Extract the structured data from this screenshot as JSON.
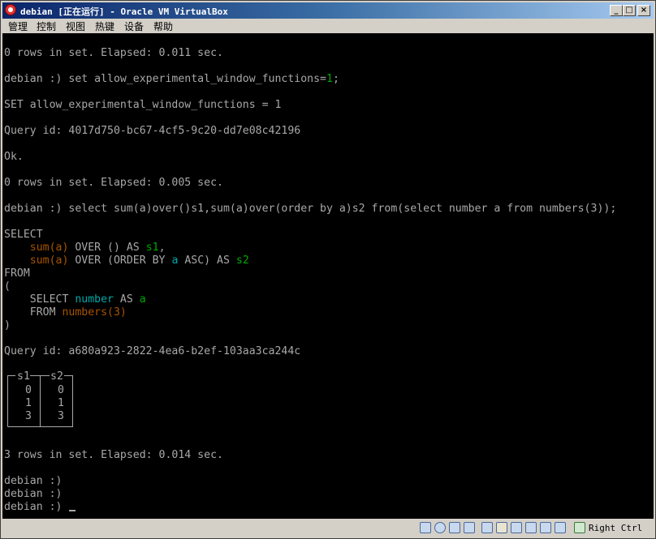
{
  "window": {
    "title": "debian [正在运行] - Oracle VM VirtualBox"
  },
  "menu": [
    "管理",
    "控制",
    "视图",
    "热键",
    "设备",
    "帮助"
  ],
  "terminal": {
    "lines": [
      [
        {
          "t": "0 rows in set. Elapsed: 0.011 sec."
        }
      ],
      [
        {
          "t": "debian :) set allow_experimental_window_functions="
        },
        {
          "t": "1",
          "c": "g"
        },
        {
          "t": ";"
        }
      ],
      [
        {
          "t": "SET allow_experimental_window_functions = 1"
        }
      ],
      [
        {
          "t": "Query id: 4017d750-bc67-4cf5-9c20-dd7e08c42196"
        }
      ],
      [
        {
          "t": "Ok."
        }
      ],
      [
        {
          "t": "0 rows in set. Elapsed: 0.005 sec."
        }
      ],
      [
        {
          "t": "debian :) select sum(a)over()s1,sum(a)over(order by a)s2 from(select number a from numbers(3));"
        }
      ],
      [
        {
          "t": "SELECT"
        }
      ],
      [
        {
          "t": "    "
        },
        {
          "t": "sum(a)",
          "c": "o"
        },
        {
          "t": " OVER () AS "
        },
        {
          "t": "s1",
          "c": "g"
        },
        {
          "t": ","
        }
      ],
      [
        {
          "t": "    "
        },
        {
          "t": "sum(a)",
          "c": "o"
        },
        {
          "t": " OVER (ORDER BY "
        },
        {
          "t": "a",
          "c": "c"
        },
        {
          "t": " ASC) AS "
        },
        {
          "t": "s2",
          "c": "g"
        }
      ],
      [
        {
          "t": "FROM"
        }
      ],
      [
        {
          "t": "("
        }
      ],
      [
        {
          "t": "    SELECT "
        },
        {
          "t": "number",
          "c": "c"
        },
        {
          "t": " AS "
        },
        {
          "t": "a",
          "c": "g"
        }
      ],
      [
        {
          "t": "    FROM "
        },
        {
          "t": "numbers(3)",
          "c": "o"
        }
      ],
      [
        {
          "t": ")"
        }
      ],
      [
        {
          "t": "Query id: a680a923-2822-4ea6-b2ef-103aa3ca244c"
        }
      ],
      [
        {
          "t": "3 rows in set. Elapsed: 0.014 sec."
        }
      ],
      [
        {
          "t": "debian :)"
        }
      ],
      [
        {
          "t": "debian :)"
        }
      ],
      [
        {
          "t": "debian :) "
        }
      ]
    ],
    "result_table": {
      "headers": [
        "s1",
        "s2"
      ],
      "rows": [
        [
          "0",
          "0"
        ],
        [
          "1",
          "1"
        ],
        [
          "3",
          "3"
        ]
      ]
    }
  },
  "status": {
    "icons": [
      "hard-disk-icon",
      "optical-drive-icon",
      "audio-icon",
      "network-icon",
      "usb-icon",
      "shared-folder-icon",
      "display-icon",
      "capture-icon",
      "recording-icon",
      "cpu-icon",
      "mouse-integration-icon",
      "keyboard-icon"
    ],
    "host_key": "Right Ctrl"
  },
  "colors": {
    "terminal_bg": "#000000",
    "terminal_fg": "#a8a8a8",
    "green": "#00a800",
    "orange": "#a85400",
    "cyan": "#00a8a8",
    "title_bar": "#0a246a"
  }
}
